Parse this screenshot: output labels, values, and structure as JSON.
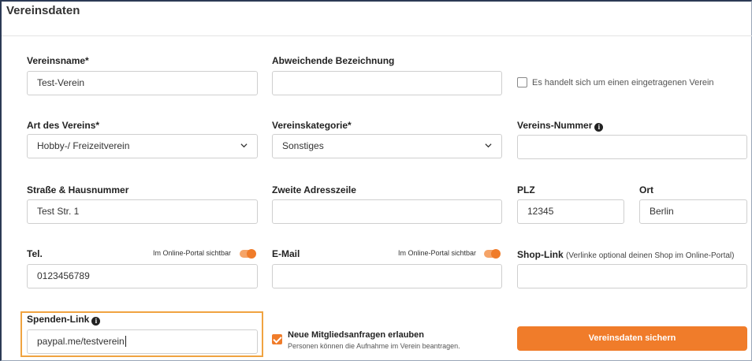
{
  "header": {
    "title": "Vereinsdaten"
  },
  "row1": {
    "vereinsname": {
      "label": "Vereinsname*",
      "value": "Test-Verein"
    },
    "abweichende": {
      "label": "Abweichende Bezeichnung",
      "value": ""
    },
    "eingetragen": {
      "label": "Es handelt sich um einen eingetragenen Verein",
      "checked": false
    }
  },
  "row2": {
    "art": {
      "label": "Art des Vereins*",
      "value": "Hobby-/ Freizeitverein"
    },
    "kategorie": {
      "label": "Vereinskategorie*",
      "value": "Sonstiges"
    },
    "nummer": {
      "label": "Vereins-Nummer",
      "value": ""
    }
  },
  "row3": {
    "strasse": {
      "label": "Straße & Hausnummer",
      "value": "Test Str. 1"
    },
    "zweite": {
      "label": "Zweite Adresszeile",
      "value": ""
    },
    "plz": {
      "label": "PLZ",
      "value": "12345"
    },
    "ort": {
      "label": "Ort",
      "value": "Berlin"
    }
  },
  "row4": {
    "tel": {
      "label": "Tel.",
      "value": "0123456789",
      "visibility_label": "Im Online-Portal sichtbar",
      "visible": true
    },
    "email": {
      "label": "E-Mail",
      "value": "",
      "visibility_label": "Im Online-Portal sichtbar",
      "visible": true
    },
    "shop": {
      "label": "Shop-Link",
      "sublabel": "(Verlinke optional deinen Shop im Online-Portal)",
      "value": ""
    }
  },
  "row5": {
    "spenden": {
      "label": "Spenden-Link",
      "value": "paypal.me/testverein"
    },
    "mitglied": {
      "title": "Neue Mitgliedsanfragen erlauben",
      "subtitle": "Personen können die Aufnahme im Verein beantragen.",
      "checked": true
    },
    "save_button": "Vereinsdaten sichern"
  },
  "colors": {
    "accent": "#f07c2a",
    "highlight": "#f0a340"
  }
}
